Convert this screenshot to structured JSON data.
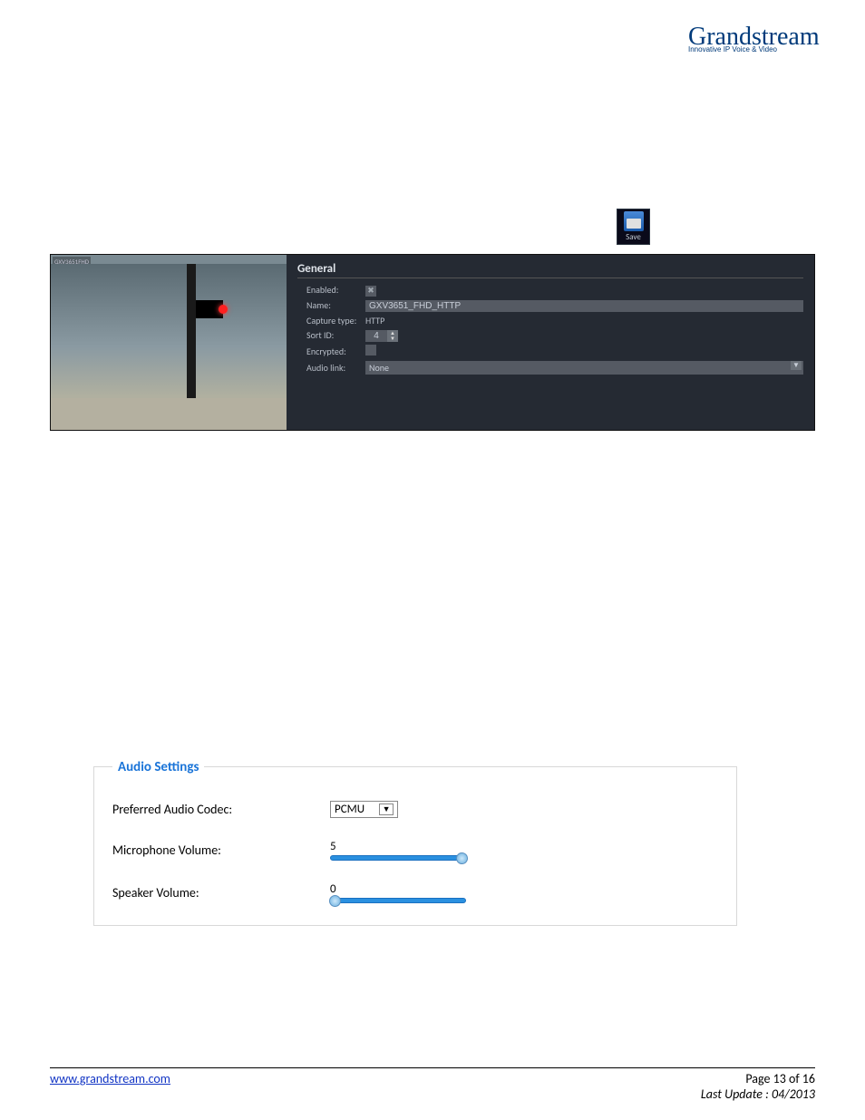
{
  "logo": {
    "name": "Grandstream",
    "tagline": "Innovative IP Voice & Video"
  },
  "save_button": "Save",
  "general_panel": {
    "title": "General",
    "camera_label": "GXV3651FHD",
    "fields": {
      "enabled": {
        "label": "Enabled:",
        "checked": true
      },
      "name": {
        "label": "Name:",
        "value": "GXV3651_FHD_HTTP"
      },
      "capture_type": {
        "label": "Capture type:",
        "value": "HTTP"
      },
      "sort_id": {
        "label": "Sort ID:",
        "value": "4"
      },
      "encrypted": {
        "label": "Encrypted:",
        "checked": false
      },
      "audio_link": {
        "label": "Audio link:",
        "value": "None"
      }
    }
  },
  "audio_settings": {
    "legend": "Audio Settings",
    "codec": {
      "label": "Preferred Audio Codec:",
      "value": "PCMU"
    },
    "mic": {
      "label": "Microphone Volume:",
      "value": "5",
      "percent": 95
    },
    "speaker": {
      "label": "Speaker Volume:",
      "value": "0",
      "percent": 0
    }
  },
  "footer": {
    "url": "www.grandstream.com",
    "page": "Page 13 of 16",
    "updated": "Last Update : 04/2013"
  }
}
